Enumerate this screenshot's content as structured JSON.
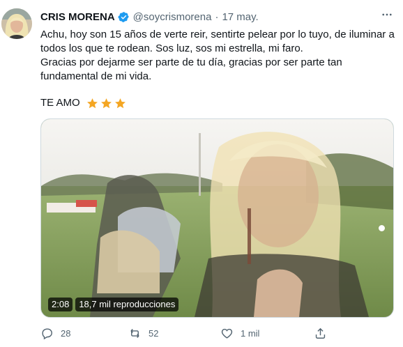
{
  "author": {
    "name": "CRIS MORENA",
    "handle": "@soycrismorena",
    "date": "17 may."
  },
  "tweet": {
    "line1": "Achu, hoy son 15 años de verte reir, sentirte pelear por lo tuyo, de iluminar a todos los que te rodean. Sos luz, sos mi estrella, mi faro.",
    "line2": "Gracias por dejarme ser parte de tu día, gracias por ser parte tan fundamental de mi vida.",
    "love": "TE AMO",
    "emoji_count": 3
  },
  "video": {
    "duration": "2:08",
    "views": "18,7 mil reproducciones"
  },
  "actions": {
    "replies": "28",
    "retweets": "52",
    "likes": "1 mil"
  },
  "colors": {
    "text": "#0f1419",
    "secondary": "#536471",
    "verified": "#1d9bf0",
    "star": "#f4a623"
  }
}
